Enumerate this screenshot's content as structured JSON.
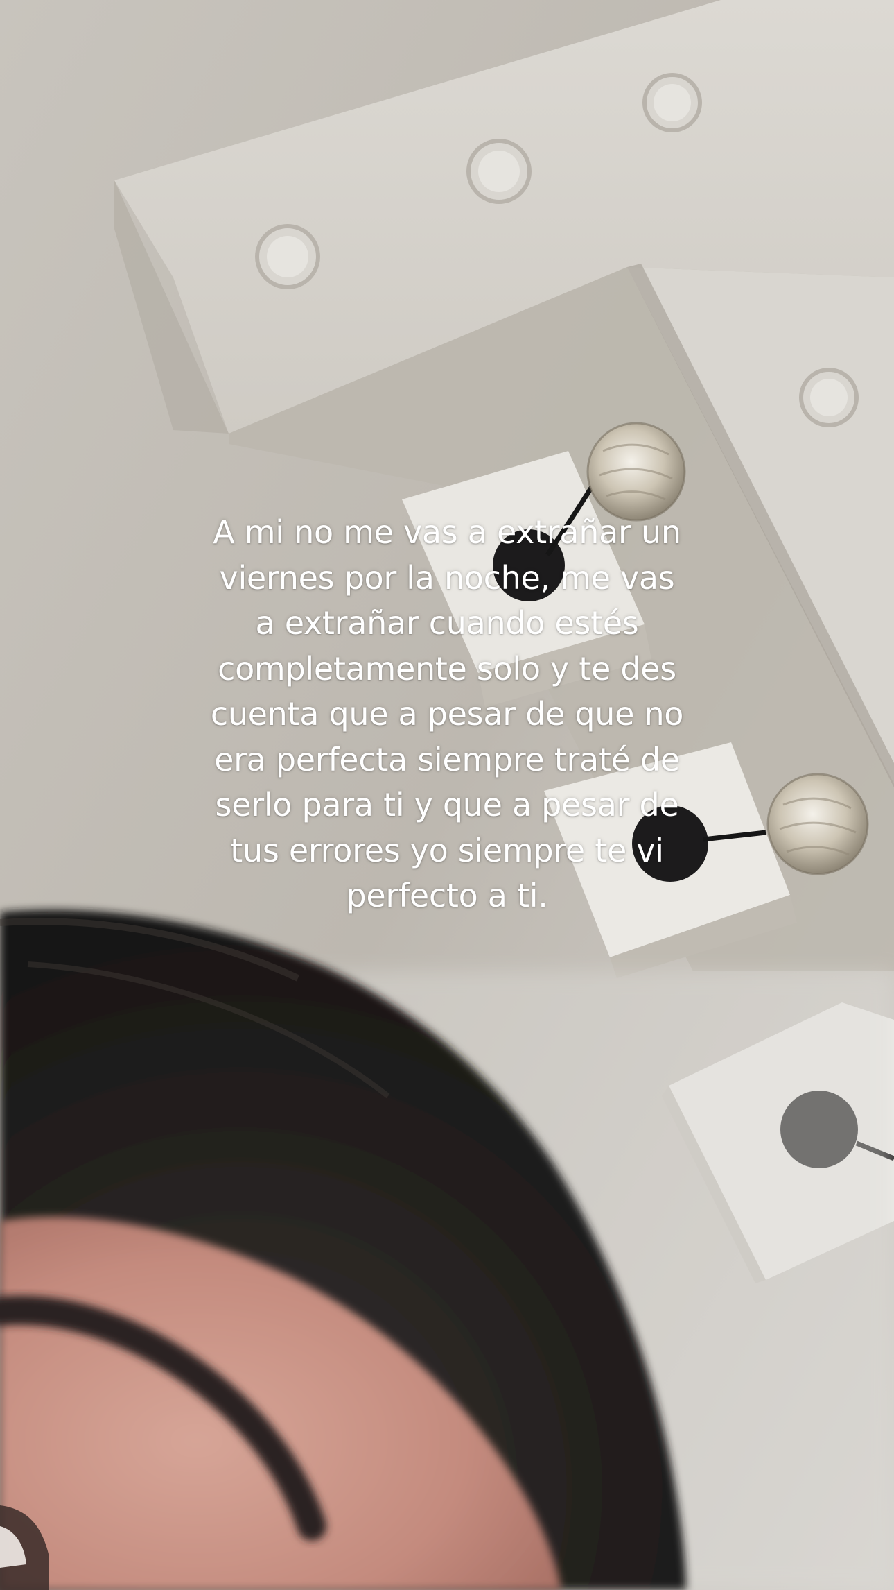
{
  "story": {
    "caption": "A mi no me vas a extrañar un\nviernes por la noche, me vas\na extrañar cuando estés\ncompletamente solo y te des\ncuenta que a pesar de que no\nera perfecta siempre traté de\nserlo para ti y que a pesar de\ntus errores yo siempre te vi\nperfecto a ti."
  },
  "colors": {
    "text": "#ffffff",
    "ceiling": "#d0ccc6",
    "hair": "#1f1d1c",
    "skin": "#c99387"
  }
}
